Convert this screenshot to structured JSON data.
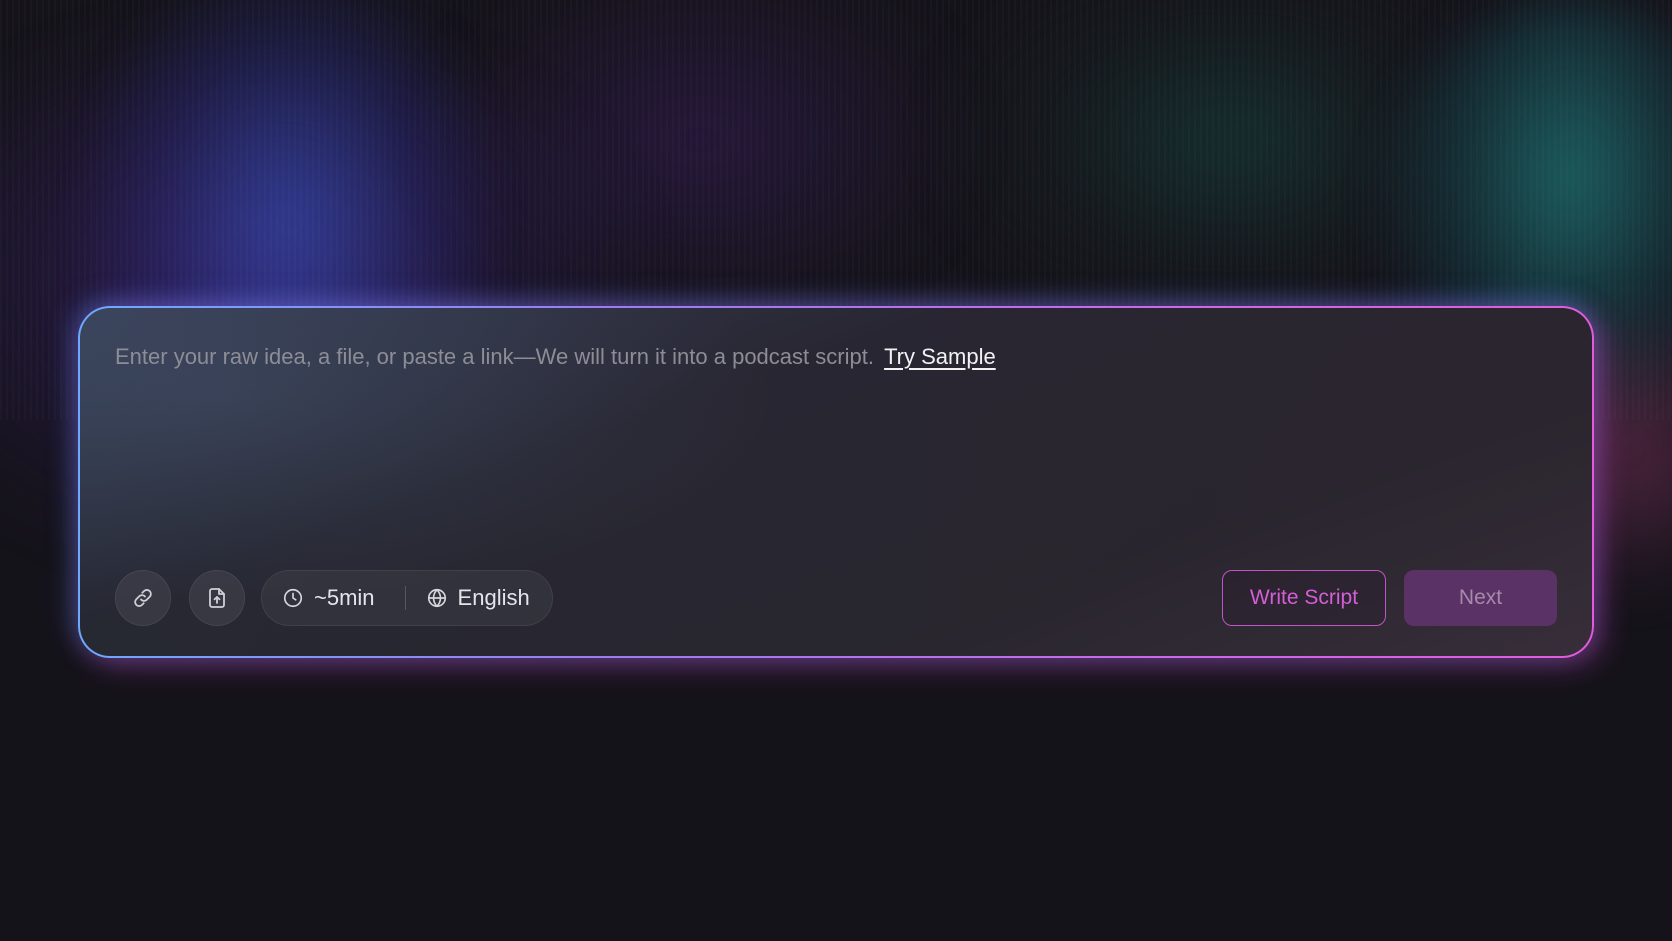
{
  "prompt": {
    "placeholder": "Enter your raw idea, a file, or paste a link—We will turn it into a podcast script.",
    "try_sample_label": "Try Sample"
  },
  "toolbar": {
    "link_icon": "link-icon",
    "upload_icon": "file-upload-icon",
    "duration": {
      "icon": "clock-icon",
      "value": "~5min"
    },
    "language": {
      "icon": "globe-icon",
      "value": "English"
    },
    "write_script_label": "Write Script",
    "next_label": "Next"
  },
  "colors": {
    "accent": "#d35ed6",
    "next_bg": "#5a3266",
    "border_gradient_start": "#6fa8ff",
    "border_gradient_end": "#e25bdc"
  }
}
